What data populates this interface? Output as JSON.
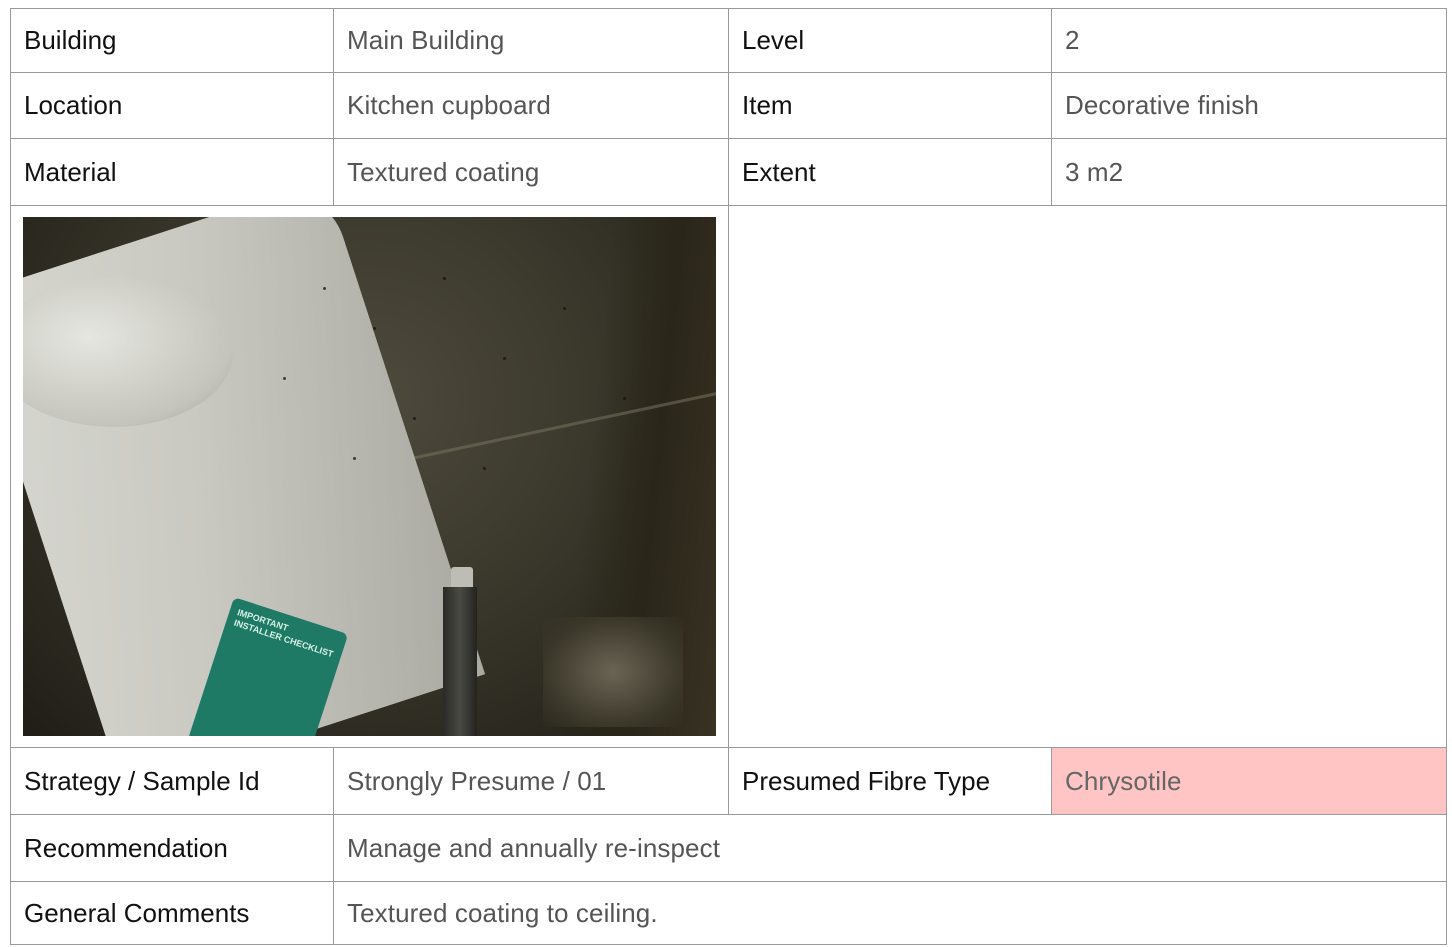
{
  "rows": {
    "building": {
      "label": "Building",
      "value": "Main Building"
    },
    "level": {
      "label": "Level",
      "value": "2"
    },
    "location": {
      "label": "Location",
      "value": "Kitchen cupboard"
    },
    "item": {
      "label": "Item",
      "value": "Decorative finish"
    },
    "material": {
      "label": "Material",
      "value": "Textured coating"
    },
    "extent": {
      "label": "Extent",
      "value": "3 m2"
    },
    "strategy": {
      "label": "Strategy / Sample Id",
      "value": "Strongly Presume / 01"
    },
    "fibre": {
      "label": "Presumed Fibre Type",
      "value": "Chrysotile",
      "highlight_color": "#ffc5c5"
    },
    "recommendation": {
      "label": "Recommendation",
      "value": "Manage and annually re-inspect"
    },
    "comments": {
      "label": "General Comments",
      "value": "Textured coating to ceiling."
    }
  },
  "photo": {
    "sticker_text": "IMPORTANT INSTALLER CHECKLIST"
  },
  "colors": {
    "border": "#9a9a9a",
    "label_text": "#111111",
    "value_text": "#555555"
  }
}
